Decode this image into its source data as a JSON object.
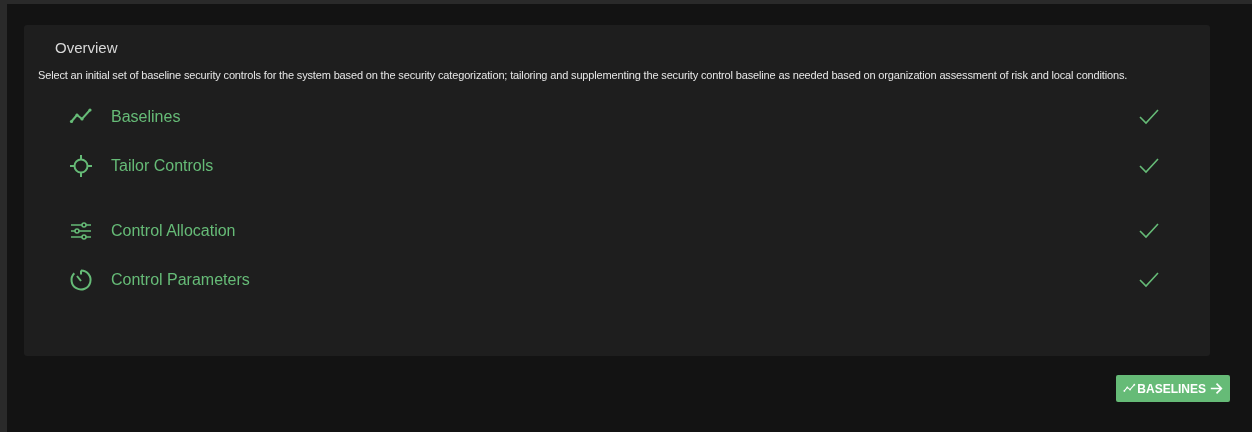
{
  "overview": {
    "title": "Overview",
    "description": "Select an initial set of baseline security controls for the system based on the security categorization; tailoring and supplementing the security control baseline as needed based on organization assessment of risk and local conditions.",
    "steps": [
      {
        "label": "Baselines",
        "completed": true
      },
      {
        "label": "Tailor Controls",
        "completed": true
      },
      {
        "label": "Control Allocation",
        "completed": true
      },
      {
        "label": "Control Parameters",
        "completed": true
      }
    ]
  },
  "next_button": {
    "label": "BASELINES"
  }
}
